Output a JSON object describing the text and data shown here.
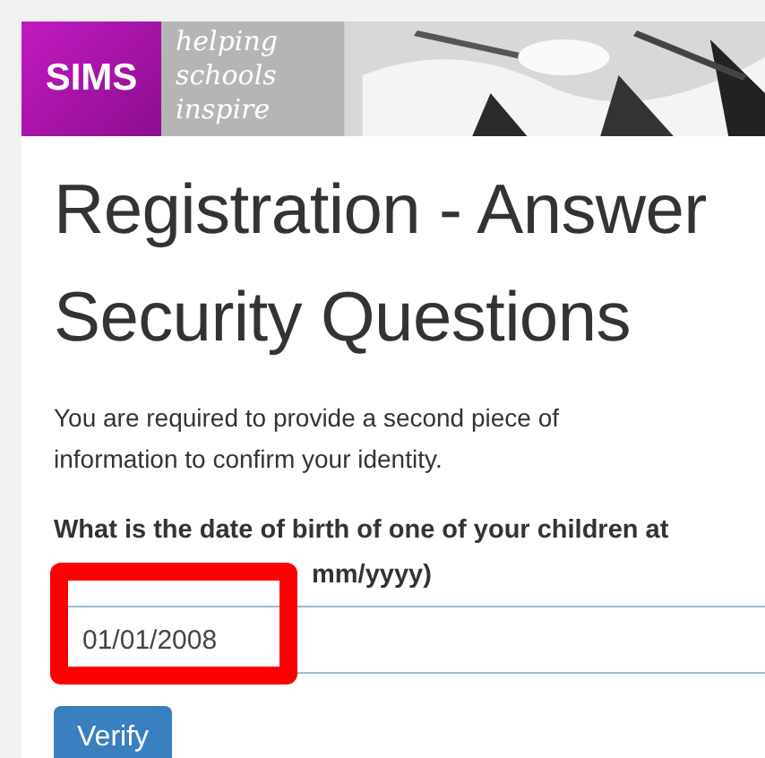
{
  "header": {
    "logo": "SIMS",
    "tagline": [
      "helping",
      "schools",
      "inspire"
    ]
  },
  "title_lines": [
    "Registration - Answer",
    "Security Questions"
  ],
  "intro": "You are required to provide a second piece of information to confirm your identity.",
  "question": {
    "label_line": "What is the date of birth of one of your children at",
    "label_visible_end": "mm/yyyy)",
    "value": "01/01/2008"
  },
  "buttons": [
    {
      "label": "Verify",
      "kind": "primary"
    }
  ],
  "annotation": {
    "kind": "highlight-box",
    "color": "#ff0000"
  }
}
